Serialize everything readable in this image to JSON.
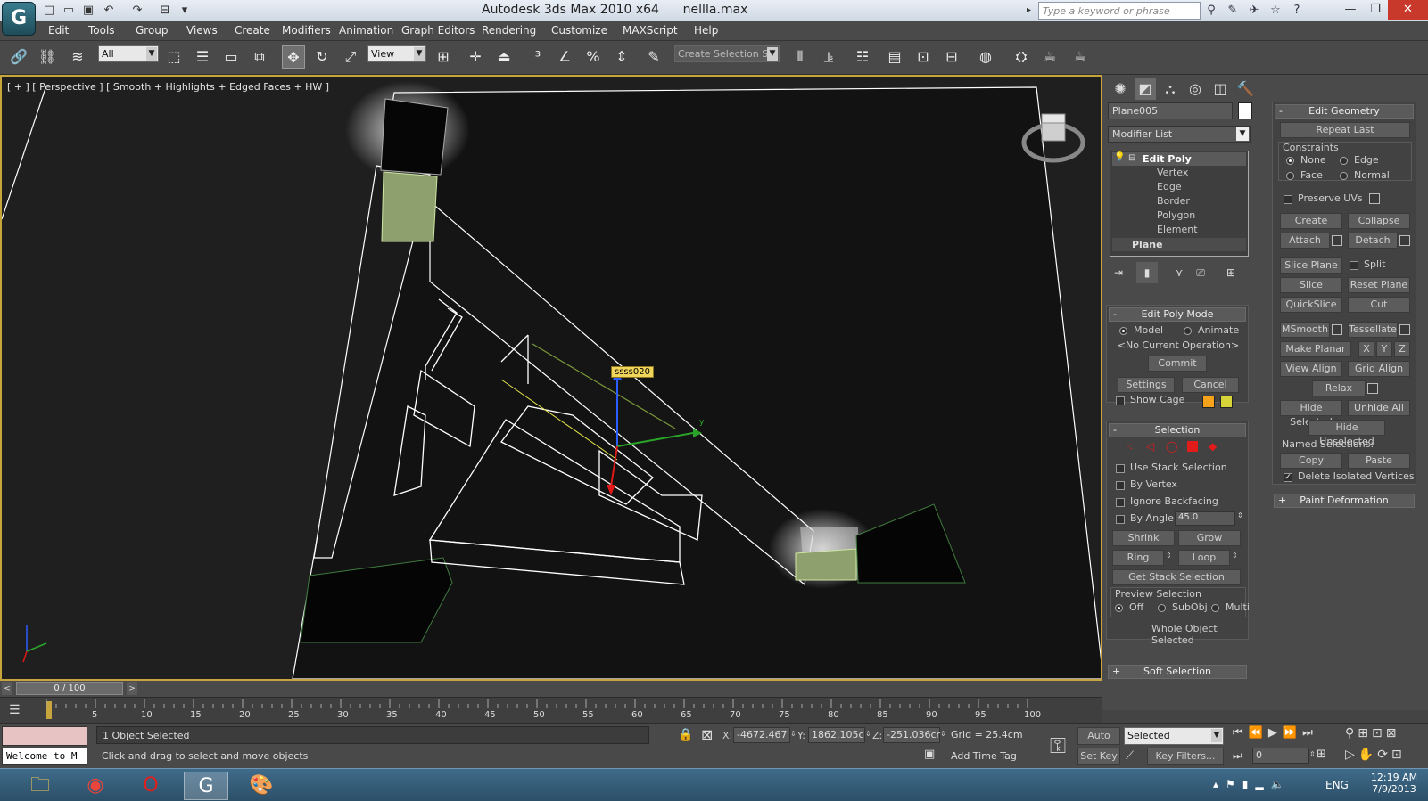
{
  "window": {
    "title": "Autodesk 3ds Max  2010 x64",
    "filename": "nellla.max",
    "search_placeholder": "Type a keyword or phrase"
  },
  "menu": [
    "Edit",
    "Tools",
    "Group",
    "Views",
    "Create",
    "Modifiers",
    "Animation",
    "Graph Editors",
    "Rendering",
    "Customize",
    "MAXScript",
    "Help"
  ],
  "toolbar": {
    "filter_value": "All",
    "refcoord_value": "View",
    "named_selection_placeholder": "Create Selection Se"
  },
  "viewport": {
    "label": "[ + ] [ Perspective ] [ Smooth + Highlights + Edged Faces + HW ]",
    "object_tag": "ssss020"
  },
  "command_panel": {
    "object_name": "Plane005",
    "modifier_list": "Modifier List",
    "stack": {
      "edit_poly": "Edit Poly",
      "subobjects": [
        "Vertex",
        "Edge",
        "Border",
        "Polygon",
        "Element"
      ],
      "base": "Plane"
    },
    "edit_poly_mode": {
      "title": "Edit Poly Mode",
      "model": "Model",
      "animate": "Animate",
      "current_op": "<No Current Operation>",
      "commit": "Commit",
      "settings": "Settings",
      "cancel": "Cancel",
      "show_cage": "Show Cage"
    },
    "selection": {
      "title": "Selection",
      "use_stack": "Use Stack Selection",
      "by_vertex": "By Vertex",
      "ignore_backfacing": "Ignore Backfacing",
      "by_angle": "By Angle:",
      "angle_value": "45.0",
      "shrink": "Shrink",
      "grow": "Grow",
      "ring": "Ring",
      "loop": "Loop",
      "get_stack": "Get Stack Selection",
      "preview_title": "Preview Selection",
      "off": "Off",
      "subobj": "SubObj",
      "multi": "Multi",
      "status": "Whole Object Selected"
    },
    "soft_selection": "Soft Selection",
    "edit_geometry": {
      "title": "Edit Geometry",
      "repeat_last": "Repeat Last",
      "constraints": "Constraints",
      "none": "None",
      "edge": "Edge",
      "face": "Face",
      "normal": "Normal",
      "preserve_uvs": "Preserve UVs",
      "create": "Create",
      "collapse": "Collapse",
      "attach": "Attach",
      "detach": "Detach",
      "slice_plane": "Slice Plane",
      "split": "Split",
      "slice": "Slice",
      "reset_plane": "Reset Plane",
      "quickslice": "QuickSlice",
      "cut": "Cut",
      "msmooth": "MSmooth",
      "tessellate": "Tessellate",
      "make_planar": "Make Planar",
      "x": "X",
      "y": "Y",
      "z": "Z",
      "view_align": "View Align",
      "grid_align": "Grid Align",
      "relax": "Relax",
      "hide_selected": "Hide Selected",
      "unhide_all": "Unhide All",
      "hide_unselected": "Hide Unselected",
      "named_selections": "Named Selections:",
      "copy": "Copy",
      "paste": "Paste",
      "delete_isolated": "Delete Isolated Vertices"
    },
    "paint_deformation": "Paint Deformation"
  },
  "timeline": {
    "frame": "0 / 100",
    "ticks": [
      "5",
      "10",
      "15",
      "20",
      "25",
      "30",
      "35",
      "40",
      "45",
      "50",
      "55",
      "60",
      "65",
      "70",
      "75",
      "80",
      "85",
      "90",
      "95",
      "100"
    ],
    "progress": 0
  },
  "status": {
    "selected": "1 Object Selected",
    "prompt": "Click and drag to select and move objects",
    "maxscript": "Welcome to M",
    "x_label": "X:",
    "x": "-4672.467",
    "y_label": "Y:",
    "y": "1862.105c",
    "z_label": "Z:",
    "z": "-251.036cr",
    "grid": "Grid = 25.4cm",
    "add_time_tag": "Add Time Tag",
    "auto_key": "Auto Key",
    "set_key": "Set Key",
    "key_mode": "Selected",
    "key_filters": "Key Filters...",
    "frame_field": "0"
  },
  "taskbar": {
    "language": "ENG",
    "time": "12:19 AM",
    "date": "7/9/2013"
  },
  "colors": {
    "viewport_border": "#c7a43c",
    "panel_bg": "#4a4a4a",
    "cage_color_1": "#f7a21b",
    "cage_color_2": "#d7d43a",
    "polygon_icon": "#e21b1b"
  }
}
